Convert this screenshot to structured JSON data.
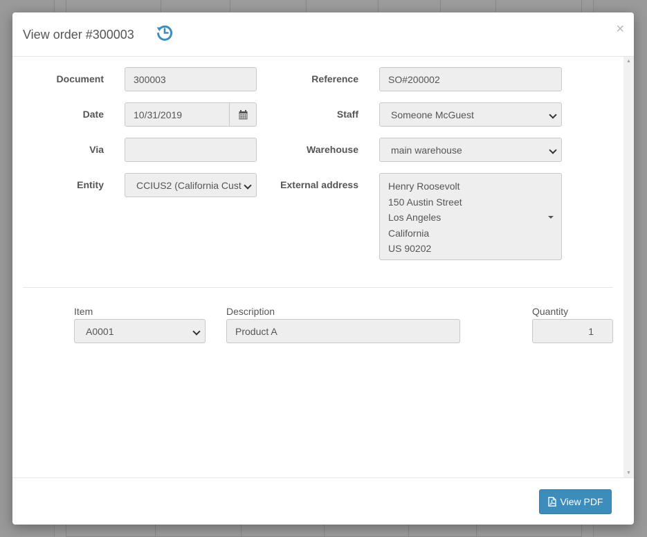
{
  "modal": {
    "title": "View order #300003",
    "close_glyph": "×"
  },
  "form": {
    "document": {
      "label": "Document",
      "value": "300003"
    },
    "reference": {
      "label": "Reference",
      "value": "SO#200002"
    },
    "date": {
      "label": "Date",
      "value": "10/31/2019"
    },
    "staff": {
      "label": "Staff",
      "value": "Someone McGuest"
    },
    "via": {
      "label": "Via",
      "value": ""
    },
    "warehouse": {
      "label": "Warehouse",
      "value": "main warehouse"
    },
    "entity": {
      "label": "Entity",
      "value": "CCIUS2 (California Cust"
    },
    "external_address": {
      "label": "External address",
      "lines": [
        "Henry Roosevolt",
        "150 Austin Street",
        "Los Angeles",
        "California",
        "US 90202"
      ]
    }
  },
  "lines_table": {
    "columns": [
      "Item",
      "Description",
      "Quantity"
    ],
    "rows": [
      {
        "item": "A0001",
        "description": "Product A",
        "quantity": "1"
      }
    ]
  },
  "footer": {
    "view_pdf_label": "View PDF"
  },
  "icons": {
    "history": "history-icon",
    "calendar": "calendar-icon",
    "pdf": "file-pdf-icon",
    "close": "close-icon"
  },
  "colors": {
    "accent": "#3c8dbc",
    "history_icon": "#3c8dbc"
  }
}
